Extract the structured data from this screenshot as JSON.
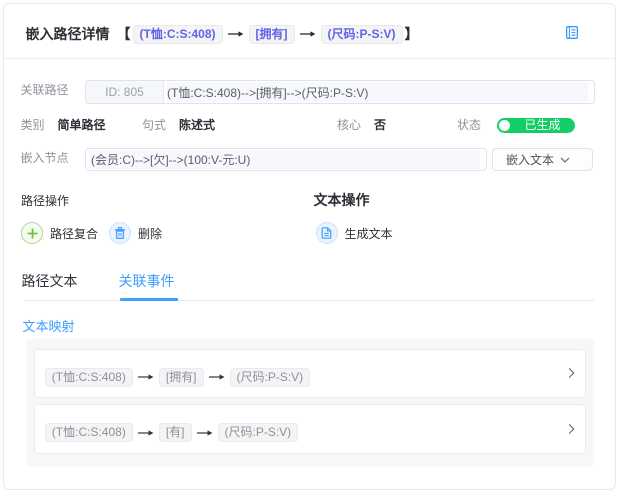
{
  "colors": {
    "accent_blue": "#409eff",
    "badge_indigo": "#6163eb",
    "switch_green": "#13ce66",
    "panel_border": "#e7e9f2",
    "text_dark": "#303133",
    "label_gray": "#8e929a"
  },
  "header": {
    "title": "嵌入路径详情",
    "bracket_open": "【",
    "bracket_close": "】",
    "path_nodes": [
      "(T恤:C:S:408)",
      "[拥有]",
      "(尺码:P-S:V)"
    ]
  },
  "related_path": {
    "label": "关联路径",
    "id_badge": "ID: 805",
    "value": "(T恤:C:S:408)-->[拥有]-->(尺码:P-S:V)"
  },
  "attributes": {
    "category": {
      "label": "类别",
      "value": "简单路径"
    },
    "sentence": {
      "label": "句式",
      "value": "陈述式"
    },
    "core": {
      "label": "核心",
      "value": "否"
    },
    "status": {
      "label": "状态",
      "switch_text": "已生成",
      "on": true
    }
  },
  "embed_node": {
    "label": "嵌入节点",
    "value": "(会员:C)-->[欠]-->(100:V-元:U)",
    "dropdown_label": "嵌入文本"
  },
  "path_ops": {
    "title": "路径操作",
    "compose_label": "路径复合",
    "delete_label": "删除"
  },
  "text_ops": {
    "title": "文本操作",
    "generate_label": "生成文本"
  },
  "tabs": {
    "path_text": "路径文本",
    "related_events": "关联事件",
    "active": "关联事件"
  },
  "text_mapping": {
    "title": "文本映射",
    "rows": [
      {
        "nodes": [
          "(T恤:C:S:408)",
          "[拥有]",
          "(尺码:P-S:V)"
        ]
      },
      {
        "nodes": [
          "(T恤:C:S:408)",
          "[有]",
          "(尺码:P-S:V)"
        ]
      }
    ]
  }
}
